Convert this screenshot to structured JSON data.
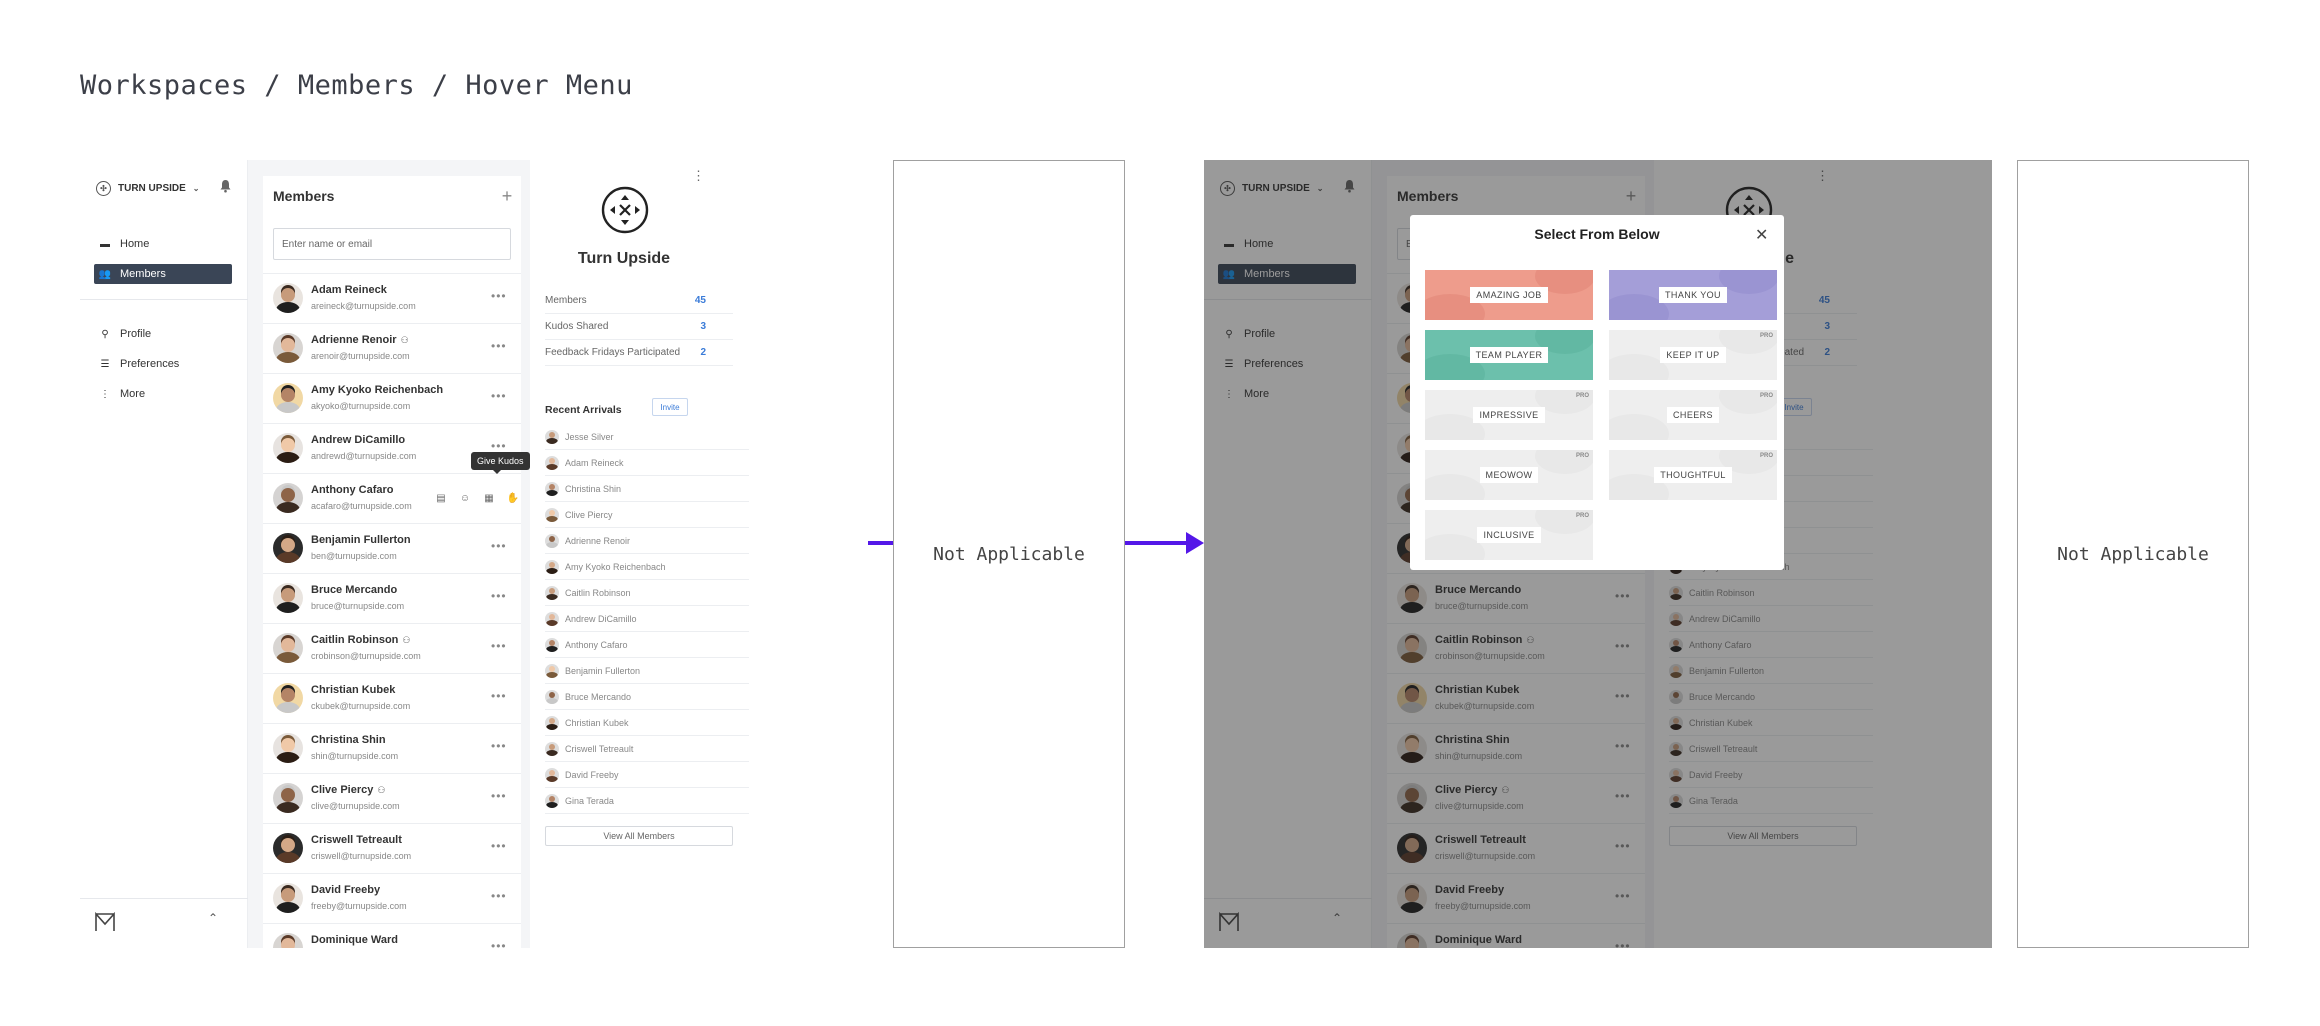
{
  "breadcrumb": "Workspaces / Members / Hover Menu",
  "workspace": {
    "name": "TURN UPSIDE"
  },
  "nav": {
    "primary": [
      {
        "label": "Home",
        "icon": "chat-icon"
      },
      {
        "label": "Members",
        "icon": "members-icon",
        "active": true
      }
    ],
    "secondary": [
      {
        "label": "Profile",
        "icon": "profile-icon"
      },
      {
        "label": "Preferences",
        "icon": "sliders-icon"
      },
      {
        "label": "More",
        "icon": "kebab-icon"
      }
    ]
  },
  "members": {
    "title": "Members",
    "search_placeholder": "Enter name or email",
    "rows": [
      {
        "name": "Adam Reineck",
        "email": "areineck@turnupside.com",
        "badge": false
      },
      {
        "name": "Adrienne Renoir",
        "email": "arenoir@turnupside.com",
        "badge": true
      },
      {
        "name": "Amy Kyoko Reichenbach",
        "email": "akyoko@turnupside.com",
        "badge": false
      },
      {
        "name": "Andrew DiCamillo",
        "email": "andrewd@turnupside.com",
        "badge": false
      },
      {
        "name": "Anthony Cafaro",
        "email": "acafaro@turnupside.com",
        "badge": false
      },
      {
        "name": "Benjamin Fullerton",
        "email": "ben@turnupside.com",
        "badge": false
      },
      {
        "name": "Bruce Mercando",
        "email": "bruce@turnupside.com",
        "badge": false
      },
      {
        "name": "Caitlin Robinson",
        "email": "crobinson@turnupside.com",
        "badge": true
      },
      {
        "name": "Christian Kubek",
        "email": "ckubek@turnupside.com",
        "badge": false
      },
      {
        "name": "Christina Shin",
        "email": "shin@turnupside.com",
        "badge": false
      },
      {
        "name": "Clive Piercy",
        "email": "clive@turnupside.com",
        "badge": true
      },
      {
        "name": "Criswell Tetreault",
        "email": "criswell@turnupside.com",
        "badge": false
      },
      {
        "name": "David Freeby",
        "email": "freeby@turnupside.com",
        "badge": false
      },
      {
        "name": "Dominique Ward",
        "email": "",
        "badge": false
      }
    ],
    "tooltip": "Give Kudos"
  },
  "workspace_panel": {
    "name": "Turn Upside",
    "stats": [
      {
        "label": "Members",
        "value": "45"
      },
      {
        "label": "Kudos Shared",
        "value": "3"
      },
      {
        "label": "Feedback Fridays Participated",
        "value": "2"
      }
    ],
    "recent_title": "Recent Arrivals",
    "invite_label": "Invite",
    "arrivals": [
      "Jesse Silver",
      "Adam Reineck",
      "Christina Shin",
      "Clive Piercy",
      "Adrienne Renoir",
      "Amy Kyoko Reichenbach",
      "Caitlin Robinson",
      "Andrew DiCamillo",
      "Anthony Cafaro",
      "Benjamin Fullerton",
      "Bruce Mercando",
      "Christian Kubek",
      "Criswell Tetreault",
      "David Freeby",
      "Gina Terada"
    ],
    "view_all": "View All Members"
  },
  "modal": {
    "title": "Select From Below",
    "cards": [
      {
        "label": "AMAZING JOB",
        "pro": false,
        "color": "#ee9c8c",
        "blob": "#d9776a"
      },
      {
        "label": "THANK YOU",
        "pro": false,
        "color": "#a49ed8",
        "blob": "#8a82c8"
      },
      {
        "label": "TEAM PLAYER",
        "pro": false,
        "color": "#6cc0ac",
        "blob": "#4fa892"
      },
      {
        "label": "KEEP IT UP",
        "pro": true,
        "color": "#eeeeee",
        "blob": "#dedede"
      },
      {
        "label": "IMPRESSIVE",
        "pro": true,
        "color": "#eeeeee",
        "blob": "#dedede"
      },
      {
        "label": "CHEERS",
        "pro": true,
        "color": "#eeeeee",
        "blob": "#dedede"
      },
      {
        "label": "MEOWOW",
        "pro": true,
        "color": "#eeeeee",
        "blob": "#dedede"
      },
      {
        "label": "THOUGHTFUL",
        "pro": true,
        "color": "#eeeeee",
        "blob": "#dedede"
      },
      {
        "label": "INCLUSIVE",
        "pro": true,
        "color": "#eeeeee",
        "blob": "#dedede"
      }
    ],
    "pro_label": "PRO"
  },
  "flow": {
    "not_applicable": "Not Applicable"
  },
  "colors": {
    "accent": "#5417e8",
    "link": "#3a7bd8",
    "nav_active": "#3a4556"
  }
}
